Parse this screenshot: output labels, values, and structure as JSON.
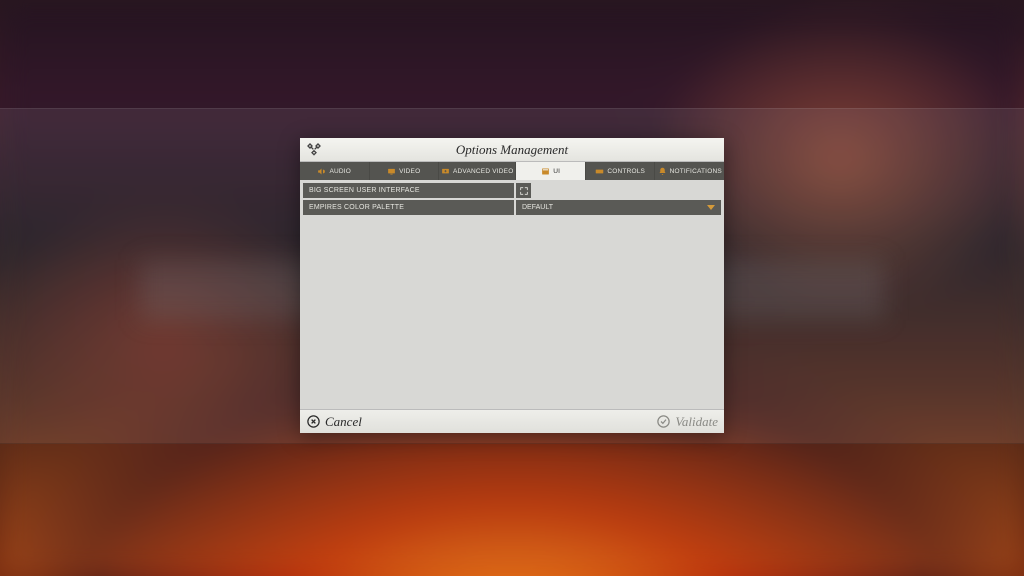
{
  "window": {
    "title": "Options Management"
  },
  "tabs": [
    {
      "label": "AUDIO",
      "active": false
    },
    {
      "label": "VIDEO",
      "active": false
    },
    {
      "label": "ADVANCED VIDEO",
      "active": false
    },
    {
      "label": "UI",
      "active": true
    },
    {
      "label": "CONTROLS",
      "active": false
    },
    {
      "label": "NOTIFICATIONS",
      "active": false
    }
  ],
  "settings": {
    "big_screen": {
      "label": "BIG SCREEN USER INTERFACE"
    },
    "palette": {
      "label": "EMPIRES COLOR PALETTE",
      "value": "DEFAULT"
    }
  },
  "footer": {
    "cancel": "Cancel",
    "validate": "Validate"
  },
  "colors": {
    "accent": "#d49a3a"
  }
}
